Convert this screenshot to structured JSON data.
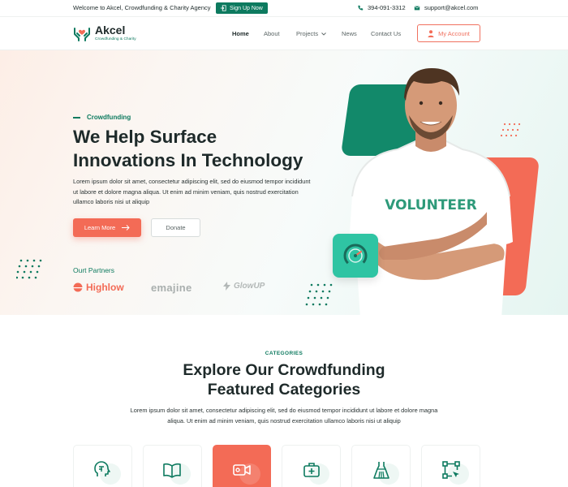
{
  "topbar": {
    "welcome": "Welcome to Akcel, Crowdfunding & Charity Agency",
    "signup_label": "Sign Up Now",
    "phone": "394-091-3312",
    "email": "support@akcel.com"
  },
  "header": {
    "brand_name": "Akcel",
    "brand_tagline": "Crowdfunding & Charity",
    "nav": [
      "Home",
      "About",
      "Projects",
      "News",
      "Contact Us"
    ],
    "account_label": "My Account"
  },
  "hero": {
    "kicker": "Crowdfunding",
    "title_line1": "We Help Surface",
    "title_line2": "Innovations In Technology",
    "lead": "Lorem ipsum dolor sit amet, consectetur adipiscing elit, sed do eiusmod tempor incididunt ut labore et dolore magna aliqua. Ut enim ad minim veniam, quis nostrud exercitation ullamco laboris nisi ut aliquip",
    "learn_more": "Learn More",
    "donate": "Donate",
    "partners_label": "Ourt Partners",
    "partners": [
      "Highlow",
      "emajine",
      "GlowUP"
    ],
    "shirt_text": "VOLUNTEER"
  },
  "categories": {
    "kicker": "CATEGORIES",
    "title_line1": "Explore Our Crowdfunding",
    "title_line2": "Featured Categories",
    "lead": "Lorem ipsum dolor sit amet, consectetur adipiscing elit, sed do eiusmod tempor incididunt ut labore et dolore magna aliqua. Ut enim ad minim veniam, quis nostrud exercitation ullamco laboris nisi ut aliquip",
    "cards": [
      {
        "icon": "brain-head-icon",
        "active": false
      },
      {
        "icon": "book-icon",
        "active": false
      },
      {
        "icon": "video-camera-icon",
        "active": true
      },
      {
        "icon": "medical-kit-icon",
        "active": false
      },
      {
        "icon": "dress-icon",
        "active": false
      },
      {
        "icon": "vector-design-icon",
        "active": false
      }
    ]
  },
  "colors": {
    "brand_green": "#0d7a5f",
    "accent_coral": "#f36b56",
    "meter_teal": "#2fc4a3"
  }
}
